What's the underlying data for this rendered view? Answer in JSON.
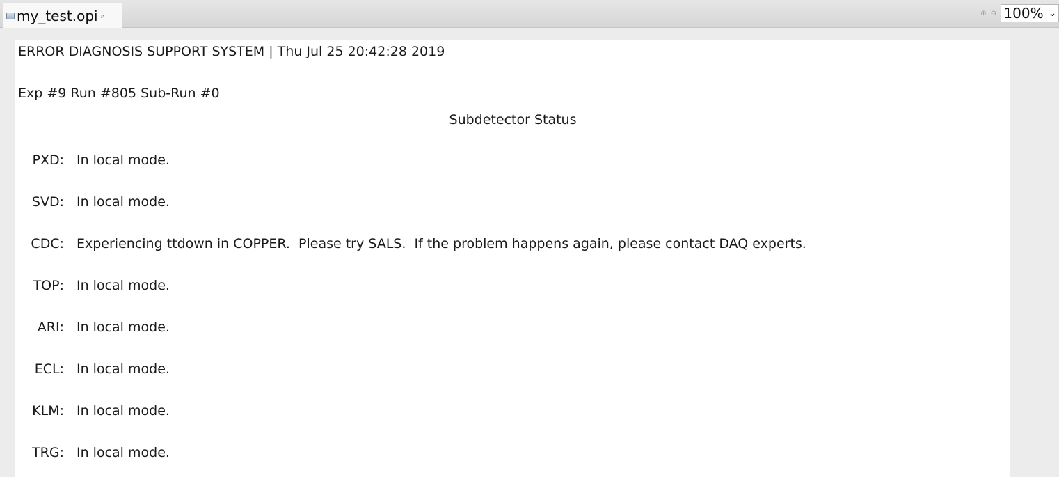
{
  "tab": {
    "title": "my_test.opi",
    "close_glyph": "¤"
  },
  "zoom": {
    "value": "100%",
    "zoom_in_icon": "zoom-in-icon",
    "zoom_out_icon": "zoom-out-icon"
  },
  "header": {
    "system_line": "ERROR DIAGNOSIS SUPPORT SYSTEM | Thu Jul 25 20:42:28 2019",
    "run_line": "Exp #9 Run #805 Sub-Run #0"
  },
  "status": {
    "title": "Subdetector Status",
    "rows": [
      {
        "name": "PXD:",
        "message": "In local mode."
      },
      {
        "name": "SVD:",
        "message": "In local mode."
      },
      {
        "name": "CDC:",
        "message": "Experiencing ttdown in COPPER.  Please try SALS.  If the problem happens again, please contact DAQ experts."
      },
      {
        "name": "TOP:",
        "message": "In local mode."
      },
      {
        "name": "ARI:",
        "message": "In local mode."
      },
      {
        "name": "ECL:",
        "message": "In local mode."
      },
      {
        "name": "KLM:",
        "message": "In local mode."
      },
      {
        "name": "TRG:",
        "message": "In local mode."
      }
    ]
  }
}
